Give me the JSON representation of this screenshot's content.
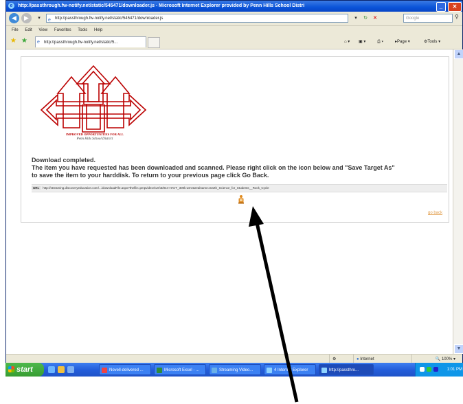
{
  "window": {
    "title": "http://passthrough.fw-notify.net/static/545471/downloader.js - Microsoft Internet Explorer provided by Penn Hills School Distri",
    "minimize": "_",
    "maximize": "❐",
    "close": "✕"
  },
  "address": {
    "url": "http://passthrough.fw-notify.net/static/545471/downloader.js",
    "search_placeholder": "Google"
  },
  "menu": [
    "File",
    "Edit",
    "View",
    "Favorites",
    "Tools",
    "Help"
  ],
  "tab": {
    "label": "http://passthrough.fw-notify.net/static/5..."
  },
  "toolbar": {
    "page_label": "Page",
    "tools_label": "Tools"
  },
  "logo": {
    "motto": "IMPROVED OPPORTUNITIES FOR ALL",
    "district": "Penn Hills School District"
  },
  "page": {
    "line1": "Download completed.",
    "line2": "The item you have requested has been downloaded and scanned. Please right click on the icon below and \"Save Target As\"",
    "line3": "to save the item to your harddisk. To return to your previous page click Go Back.",
    "url_label": "URL",
    "url_value": "http://streaming.discoveryeducation.com/.../downloadFile.aspx?thefile=pmpvideos\\vm\\6/844-HAVT_300k.wmv&realname=Earth_Science_for_Students__Rock_Cycle",
    "go_back": "go back"
  },
  "status": {
    "zone": "Internet",
    "zoom": "100%"
  },
  "taskbar": {
    "start": "start",
    "tasks": [
      "Novell-delivered ...",
      "Microsoft Excel - ...",
      "Streaming Video...",
      "4 Internet Explorer",
      "http://passthro..."
    ],
    "clock": "1:01 PM"
  }
}
